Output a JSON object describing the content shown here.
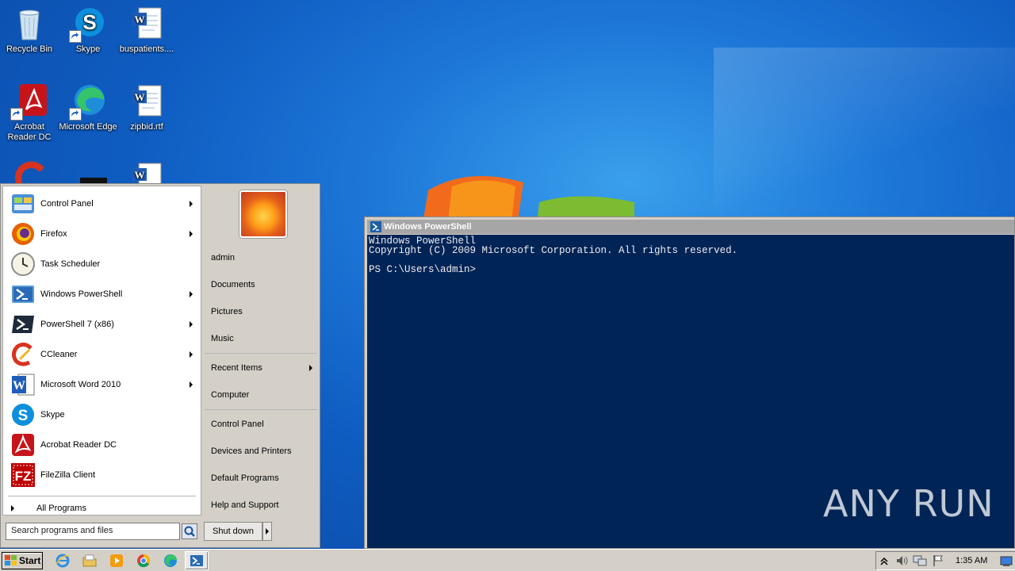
{
  "desktop": {
    "icons": [
      {
        "label": "Recycle Bin"
      },
      {
        "label": "Skype"
      },
      {
        "label": "buspatients...."
      },
      {
        "label": "Acrobat Reader DC"
      },
      {
        "label": "Microsoft Edge"
      },
      {
        "label": "zipbid.rtf"
      }
    ]
  },
  "start_menu": {
    "programs": [
      {
        "label": "Control Panel",
        "submenu": true
      },
      {
        "label": "Firefox",
        "submenu": true
      },
      {
        "label": "Task Scheduler",
        "submenu": false
      },
      {
        "label": "Windows PowerShell",
        "submenu": true
      },
      {
        "label": "PowerShell 7 (x86)",
        "submenu": true
      },
      {
        "label": "CCleaner",
        "submenu": true
      },
      {
        "label": "Microsoft Word 2010",
        "submenu": true
      },
      {
        "label": "Skype",
        "submenu": false
      },
      {
        "label": "Acrobat Reader DC",
        "submenu": false
      },
      {
        "label": "FileZilla Client",
        "submenu": false
      }
    ],
    "all_programs": "All Programs",
    "search_placeholder": "Search programs and files",
    "right": {
      "user": "admin",
      "documents": "Documents",
      "pictures": "Pictures",
      "music": "Music",
      "recent_items": "Recent Items",
      "computer": "Computer",
      "control_panel": "Control Panel",
      "devices_printers": "Devices and Printers",
      "default_programs": "Default Programs",
      "help_support": "Help and Support"
    },
    "shutdown": "Shut down"
  },
  "powershell": {
    "title": "Windows PowerShell",
    "lines": [
      "Windows PowerShell",
      "Copyright (C) 2009 Microsoft Corporation. All rights reserved.",
      "",
      "PS C:\\Users\\admin>"
    ]
  },
  "watermark": "ANY RUN",
  "taskbar": {
    "start_label": "Start",
    "clock": "1:35 AM"
  },
  "colors": {
    "ps_background": "#012456",
    "taskbar": "#d4d0c8"
  }
}
